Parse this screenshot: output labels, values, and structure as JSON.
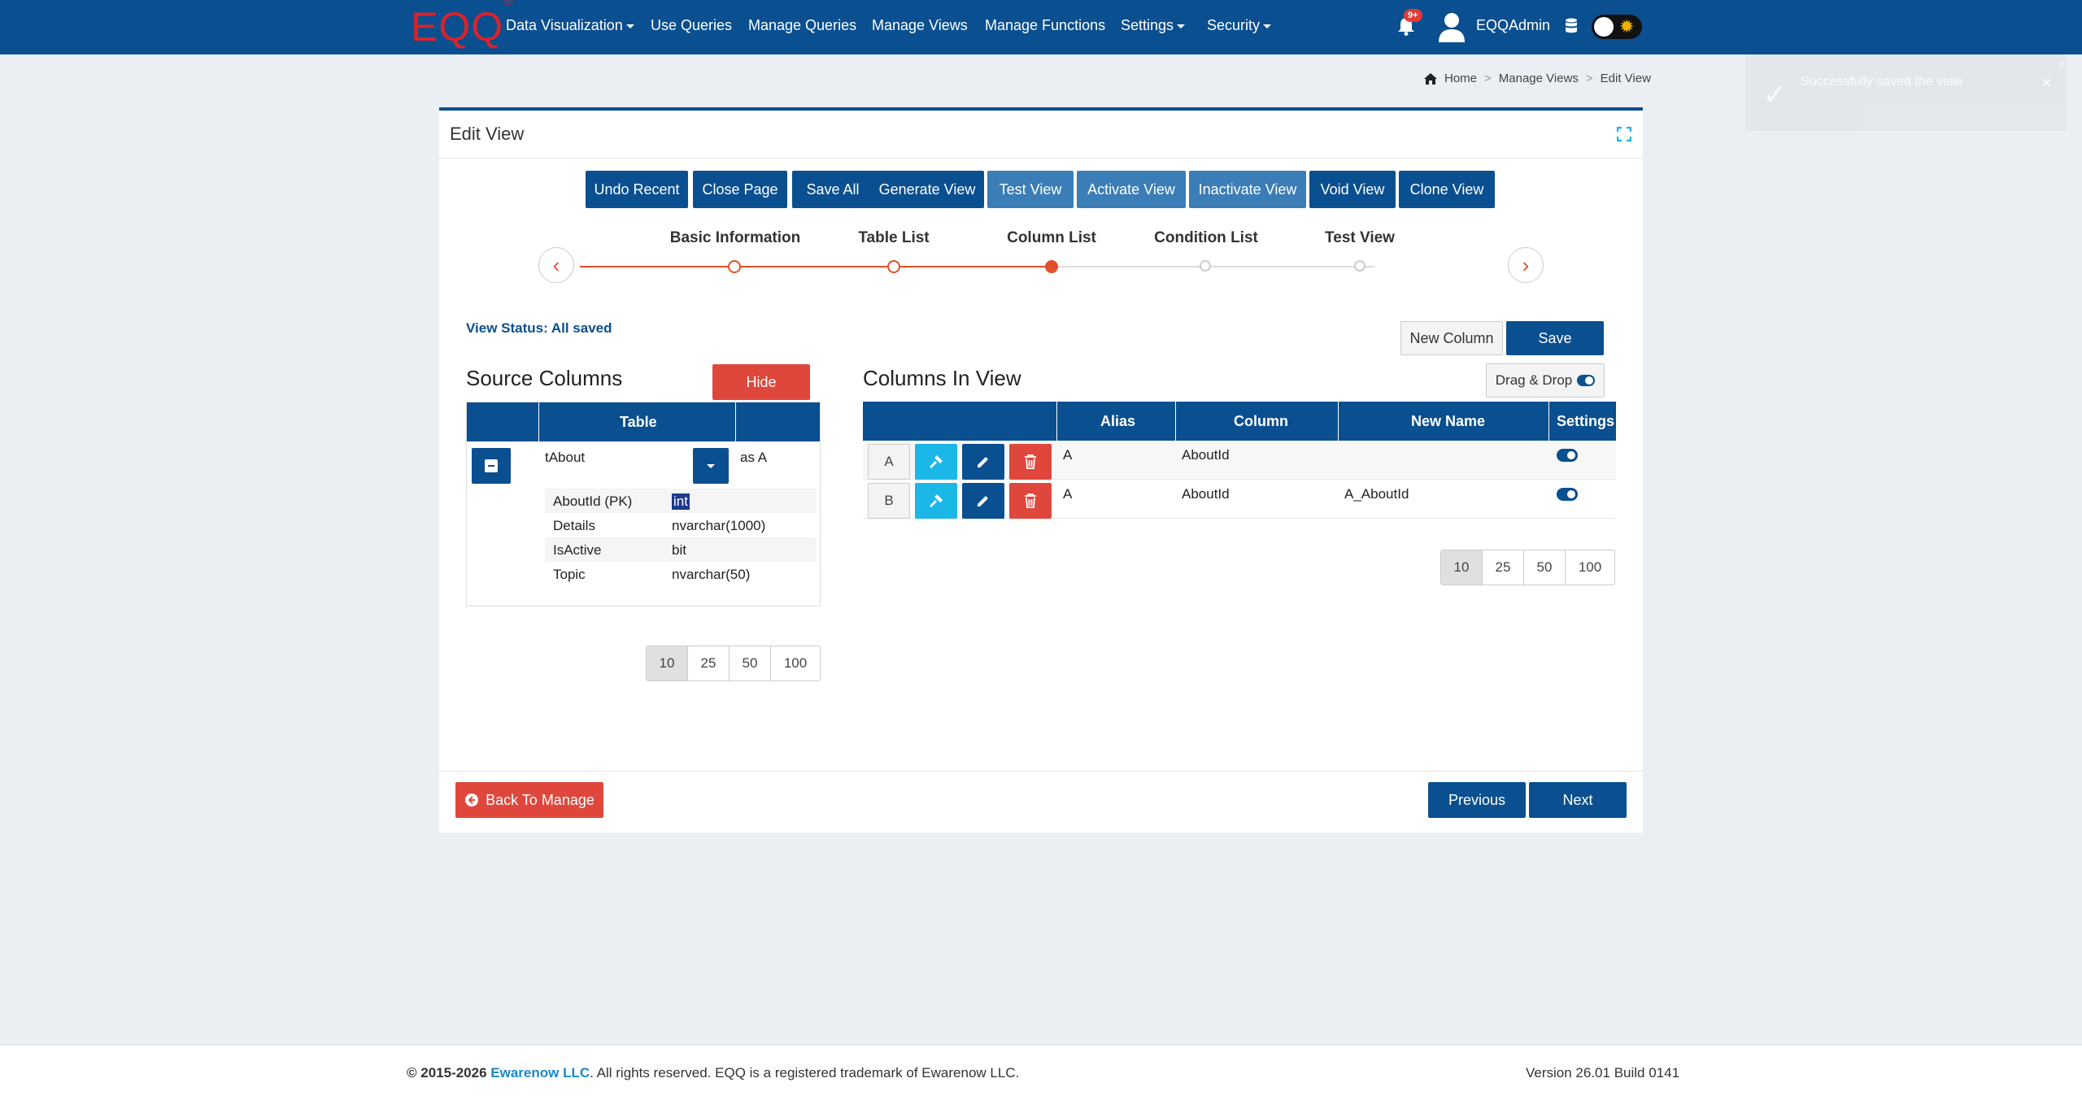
{
  "brand": {
    "logo": "EQQ",
    "logo_mark": "®"
  },
  "nav": {
    "items": [
      {
        "label": "Data Visualization",
        "dropdown": true
      },
      {
        "label": "Use Queries",
        "dropdown": false
      },
      {
        "label": "Manage Queries",
        "dropdown": false
      },
      {
        "label": "Manage Views",
        "dropdown": false
      },
      {
        "label": "Manage Functions",
        "dropdown": false
      },
      {
        "label": "Settings",
        "dropdown": true
      },
      {
        "label": "Security",
        "dropdown": true
      }
    ],
    "notification_count": "9+",
    "username": "EQQAdmin"
  },
  "toast": {
    "message": "Successfully saved the view",
    "close": "×",
    "x": "×"
  },
  "breadcrumb": [
    "Home",
    "Manage Views",
    "Edit View"
  ],
  "card": {
    "title": "Edit View",
    "toolbar": [
      "Undo Recent",
      "Close Page",
      "Save All",
      "Generate View",
      "Test View",
      "Activate View",
      "Inactivate View",
      "Void View",
      "Clone View"
    ]
  },
  "stepper": {
    "steps": [
      "Basic Information",
      "Table List",
      "Column List",
      "Condition List",
      "Test View"
    ],
    "current_step": 3
  },
  "view_status": "View Status: All saved",
  "buttons": {
    "new_column": "New Column",
    "save": "Save",
    "hide": "Hide",
    "drag_drop": "Drag & Drop",
    "back": "Back To Manage",
    "previous": "Previous",
    "next": "Next"
  },
  "source": {
    "title": "Source Columns",
    "header": "Table",
    "table_name": "tAbout",
    "alias": "as A",
    "fields": [
      {
        "name": "AboutId (PK)",
        "type": "int"
      },
      {
        "name": "Details",
        "type": "nvarchar(1000)"
      },
      {
        "name": "IsActive",
        "type": "bit"
      },
      {
        "name": "Topic",
        "type": "nvarchar(50)"
      }
    ]
  },
  "view_columns": {
    "title": "Columns In View",
    "headers": [
      "Alias",
      "Column",
      "New Name",
      "Settings"
    ],
    "rows": [
      {
        "letter": "A",
        "alias": "A",
        "column": "AboutId",
        "new_name": ""
      },
      {
        "letter": "B",
        "alias": "A",
        "column": "AboutId",
        "new_name": "A_AboutId"
      }
    ]
  },
  "pager": {
    "sizes": [
      "10",
      "25",
      "50",
      "100"
    ],
    "active": "10"
  },
  "footer": {
    "copyright": "© 2015-2026",
    "company": "Ewarenow LLC",
    "rights": ". All rights reserved. EQQ is a registered trademark of Ewarenow LLC.",
    "version": "Version 26.01 Build 0141"
  },
  "colors": {
    "primary": "#0a4f8f",
    "accent": "#e2502b",
    "danger": "#e0473c",
    "info": "#1bb7e6"
  }
}
